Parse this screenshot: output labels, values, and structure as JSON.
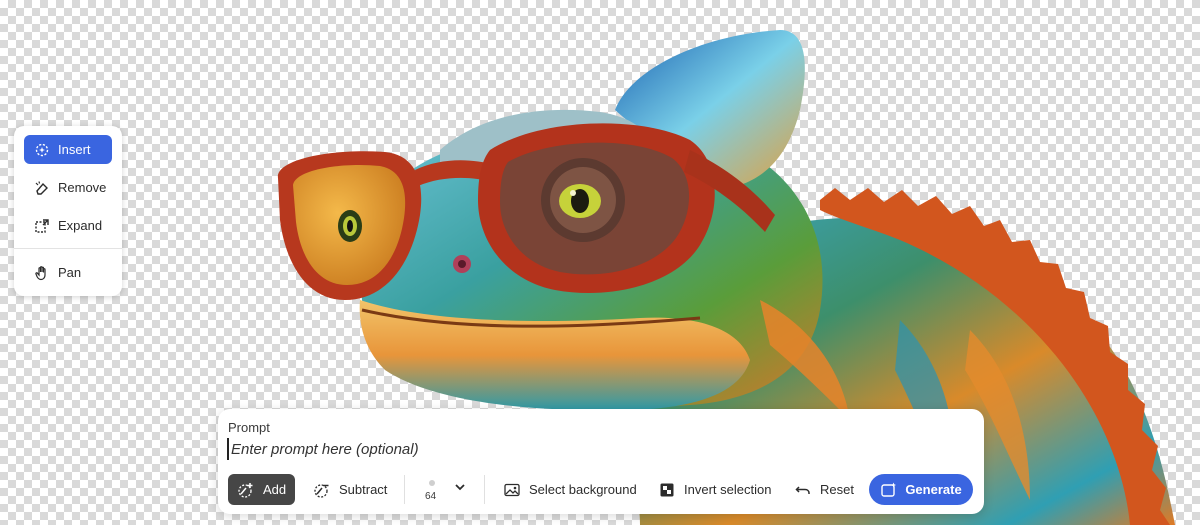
{
  "side_toolbar": {
    "items": [
      {
        "label": "Insert",
        "icon": "insert-sparkle-icon",
        "active": true
      },
      {
        "label": "Remove",
        "icon": "remove-eraser-icon",
        "active": false
      },
      {
        "label": "Expand",
        "icon": "expand-icon",
        "active": false
      },
      {
        "label": "Pan",
        "icon": "hand-icon",
        "active": false
      }
    ]
  },
  "prompt": {
    "label": "Prompt",
    "placeholder": "Enter prompt here (optional)",
    "value": ""
  },
  "actions": {
    "add": "Add",
    "subtract": "Subtract",
    "brush_size": "64",
    "select_background": "Select background",
    "invert_selection": "Invert selection",
    "reset": "Reset",
    "generate": "Generate"
  },
  "colors": {
    "accent": "#3a65e0",
    "add_button": "#464646"
  }
}
